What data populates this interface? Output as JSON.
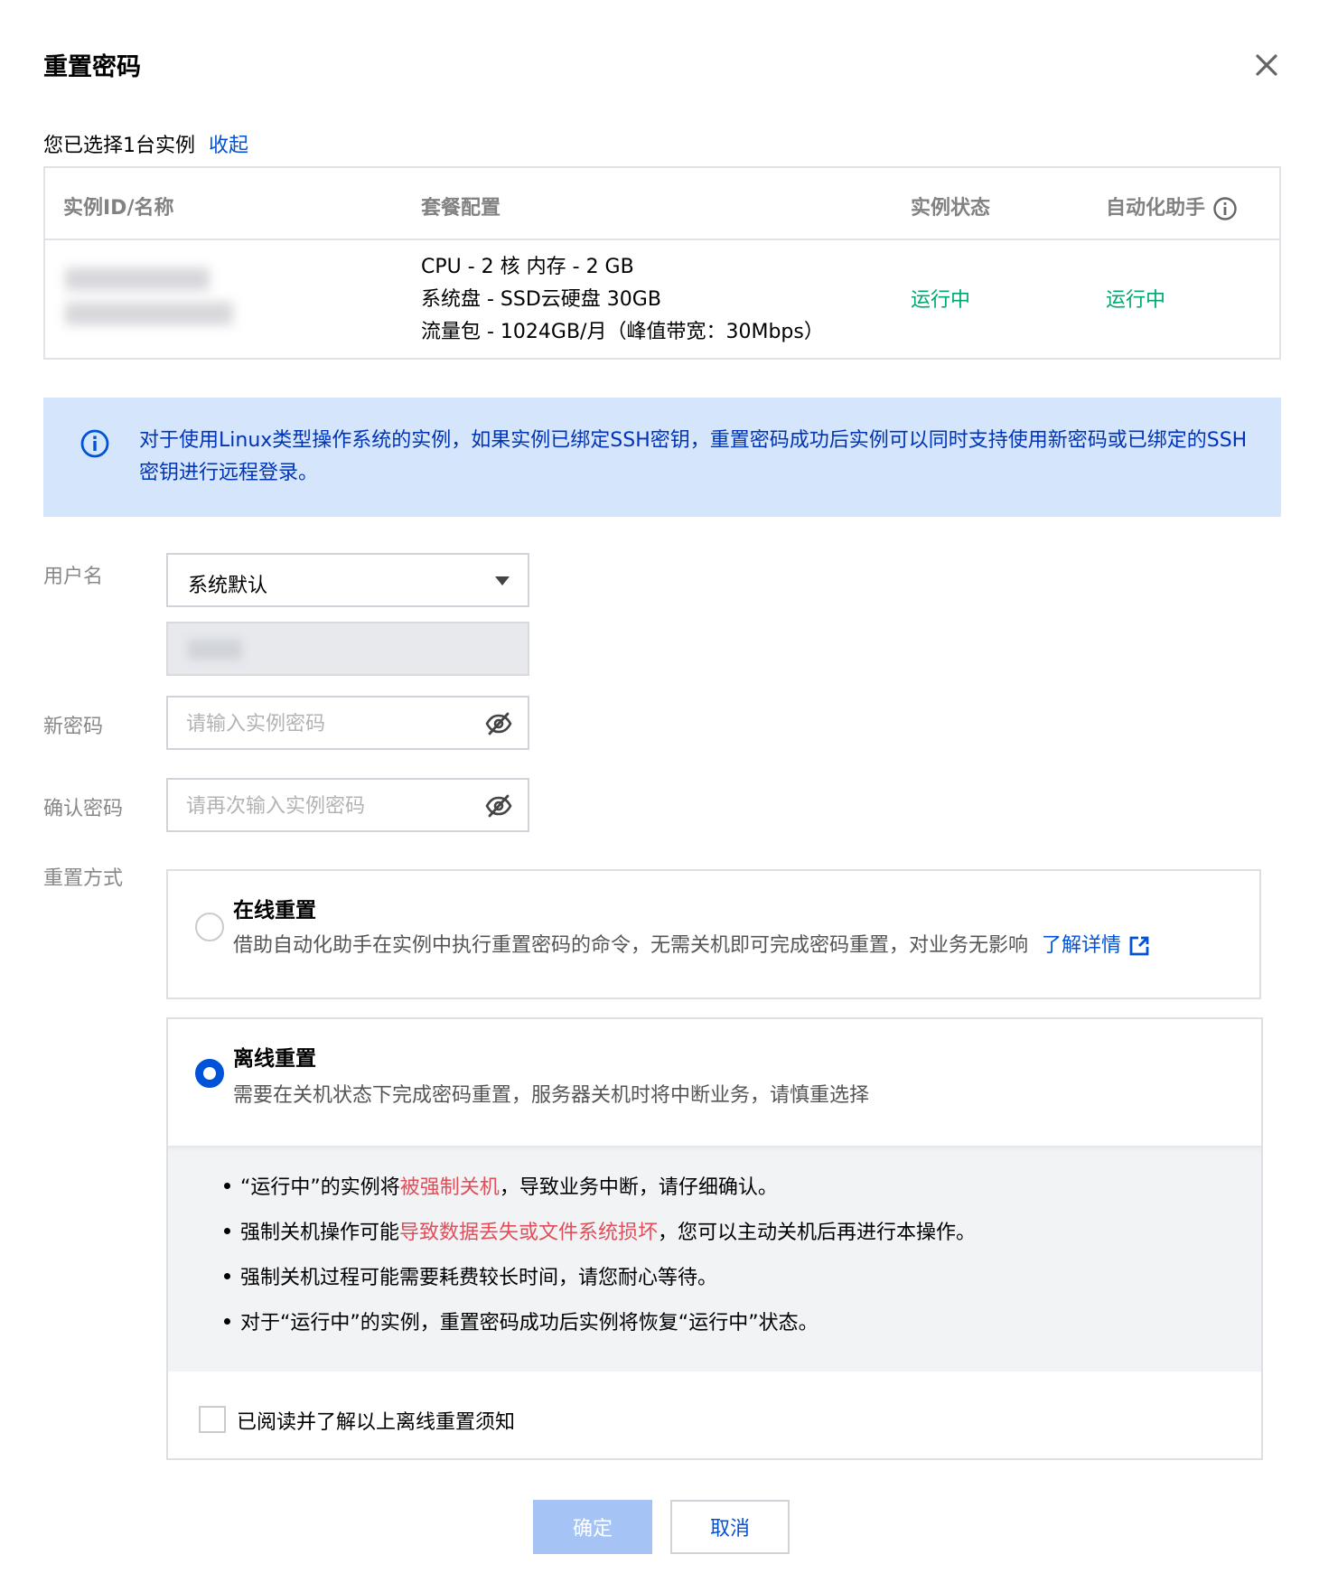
{
  "dialog": {
    "title": "重置密码"
  },
  "selection": {
    "text": "您已选择1台实例",
    "collapse_label": "收起"
  },
  "instance_table": {
    "columns": [
      "实例ID/名称",
      "套餐配置",
      "实例状态",
      "自动化助手"
    ],
    "row": {
      "spec_lines": [
        "CPU - 2 核 内存 - 2 GB",
        "系统盘 - SSD云硬盘 30GB",
        "流量包 - 1024GB/月（峰值带宽：30Mbps）"
      ],
      "status": "运行中",
      "automation": "运行中"
    }
  },
  "notice": {
    "text": "对于使用Linux类型操作系统的实例，如果实例已绑定SSH密钥，重置密码成功后实例可以同时支持使用新密码或已绑定的SSH密钥进行远程登录。"
  },
  "form": {
    "username_label": "用户名",
    "username_value": "系统默认",
    "new_password_label": "新密码",
    "new_password_placeholder": "请输入实例密码",
    "confirm_password_label": "确认密码",
    "confirm_password_placeholder": "请再次输入实例密码",
    "reset_mode_label": "重置方式"
  },
  "options": {
    "online": {
      "title": "在线重置",
      "desc": "借助自动化助手在实例中执行重置密码的命令，无需关机即可完成密码重置，对业务无影响",
      "link": "了解详情",
      "selected": false
    },
    "offline": {
      "title": "离线重置",
      "desc": "需要在关机状态下完成密码重置，服务器关机时将中断业务，请慎重选择",
      "selected": true,
      "warnings": [
        {
          "before": "“运行中”的实例将",
          "highlight": "被强制关机",
          "after": "，导致业务中断，请仔细确认。"
        },
        {
          "before": "强制关机操作可能",
          "highlight": "导致数据丢失或文件系统损坏",
          "after": "，您可以主动关机后再进行本操作。"
        },
        {
          "before": "强制关机过程可能需要耗费较长时间，请您耐心等待。",
          "highlight": "",
          "after": ""
        },
        {
          "before": "对于“运行中”的实例，重置密码成功后实例将恢复“运行中”状态。",
          "highlight": "",
          "after": ""
        }
      ],
      "ack_label": "已阅读并了解以上离线重置须知",
      "ack_checked": false
    }
  },
  "buttons": {
    "ok": "确定",
    "cancel": "取消"
  },
  "colors": {
    "primary": "#0052d9",
    "success": "#00a870",
    "danger": "#e34d59",
    "notice_bg": "#d5e6fc",
    "disabled_btn": "#a5c4f5"
  }
}
